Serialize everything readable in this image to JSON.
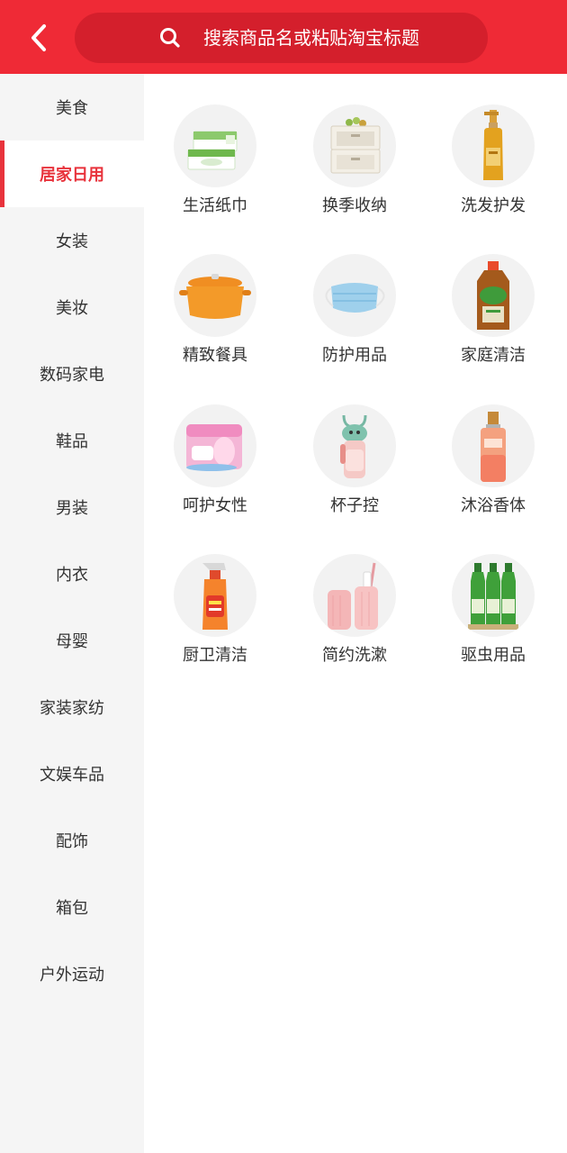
{
  "header": {
    "back_icon": "chevron-left-icon",
    "search_icon": "search-icon",
    "search_placeholder": "搜索商品名或粘贴淘宝标题",
    "bg_color": "#ef2a36"
  },
  "sidebar": {
    "active_index": 1,
    "active_color": "#e8333c",
    "items": [
      {
        "label": "美食"
      },
      {
        "label": "居家日用"
      },
      {
        "label": "女装"
      },
      {
        "label": "美妆"
      },
      {
        "label": "数码家电"
      },
      {
        "label": "鞋品"
      },
      {
        "label": "男装"
      },
      {
        "label": "内衣"
      },
      {
        "label": "母婴"
      },
      {
        "label": "家装家纺"
      },
      {
        "label": "文娱车品"
      },
      {
        "label": "配饰"
      },
      {
        "label": "箱包"
      },
      {
        "label": "户外运动"
      }
    ]
  },
  "categories": [
    {
      "label": "生活纸巾",
      "icon": "tissue-box-icon"
    },
    {
      "label": "换季收纳",
      "icon": "storage-drawer-icon"
    },
    {
      "label": "洗发护发",
      "icon": "shampoo-bottle-icon"
    },
    {
      "label": "精致餐具",
      "icon": "cast-iron-pot-icon"
    },
    {
      "label": "防护用品",
      "icon": "face-mask-icon"
    },
    {
      "label": "家庭清洁",
      "icon": "disinfectant-bottle-icon"
    },
    {
      "label": "呵护女性",
      "icon": "sanitary-pad-pack-icon"
    },
    {
      "label": "杯子控",
      "icon": "water-bottle-icon"
    },
    {
      "label": "沐浴香体",
      "icon": "body-mist-bottle-icon"
    },
    {
      "label": "厨卫清洁",
      "icon": "spray-cleaner-icon"
    },
    {
      "label": "简约洗漱",
      "icon": "toothbrush-cup-icon"
    },
    {
      "label": "驱虫用品",
      "icon": "insect-repellent-bottles-icon"
    }
  ]
}
